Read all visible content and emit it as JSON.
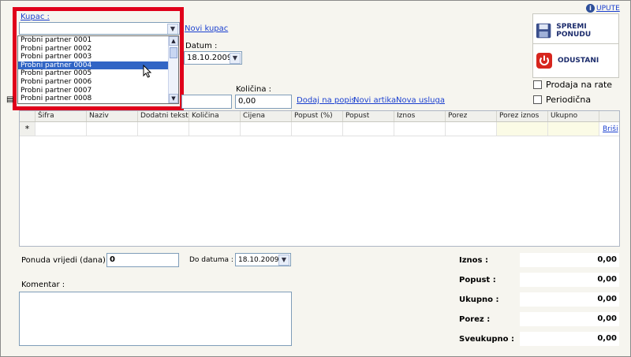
{
  "header": {
    "kupac_label": "Kupac :",
    "novi_kupac_link": "Novi kupac",
    "datum_label": "Datum :",
    "datum_value": "18.10.2009",
    "upute_link": "UPUTE"
  },
  "dropdown": {
    "value": "",
    "items": [
      "Probni partner 0001",
      "Probni partner 0002",
      "Probni partner 0003",
      "Probni partner 0004",
      "Probni partner 0005",
      "Probni partner 0006",
      "Probni partner 0007",
      "Probni partner 0008"
    ],
    "selected_index": 3
  },
  "actions": {
    "spremi_label": "SPREMI PONUDU",
    "odustani_label": "ODUSTANI",
    "prodaja_label": "Prodaja na rate",
    "periodicna_label": "Periodična"
  },
  "article_entry": {
    "kolicina_label": "Količina :",
    "kolicina_value": "0,00",
    "dodaj_link": "Dodaj na popis",
    "novi_artikal_link": "Novi artikal",
    "nova_usluga_link": "Nova usluga"
  },
  "grid": {
    "columns": [
      "Šifra",
      "Naziv",
      "Dodatni tekst",
      "Količina",
      "Cijena",
      "Popust (%)",
      "Popust",
      "Iznos",
      "Porez",
      "Porez iznos",
      "Ukupno"
    ],
    "new_row_marker": "*",
    "delete_link": "Briši"
  },
  "footer": {
    "ponuda_label": "Ponuda vrijedi (dana) :",
    "ponuda_value": "0",
    "do_datuma_label": "Do datuma :",
    "do_datuma_value": "18.10.2009",
    "komentar_label": "Komentar :"
  },
  "totals": [
    {
      "label": "Iznos :",
      "value": "0,00"
    },
    {
      "label": "Popust :",
      "value": "0,00"
    },
    {
      "label": "Ukupno :",
      "value": "0,00"
    },
    {
      "label": "Porez :",
      "value": "0,00"
    },
    {
      "label": "Sveukupno :",
      "value": "0,00"
    }
  ],
  "colors": {
    "highlight_border": "#e0001a",
    "link": "#1a3fcf",
    "selection": "#3165c5"
  }
}
